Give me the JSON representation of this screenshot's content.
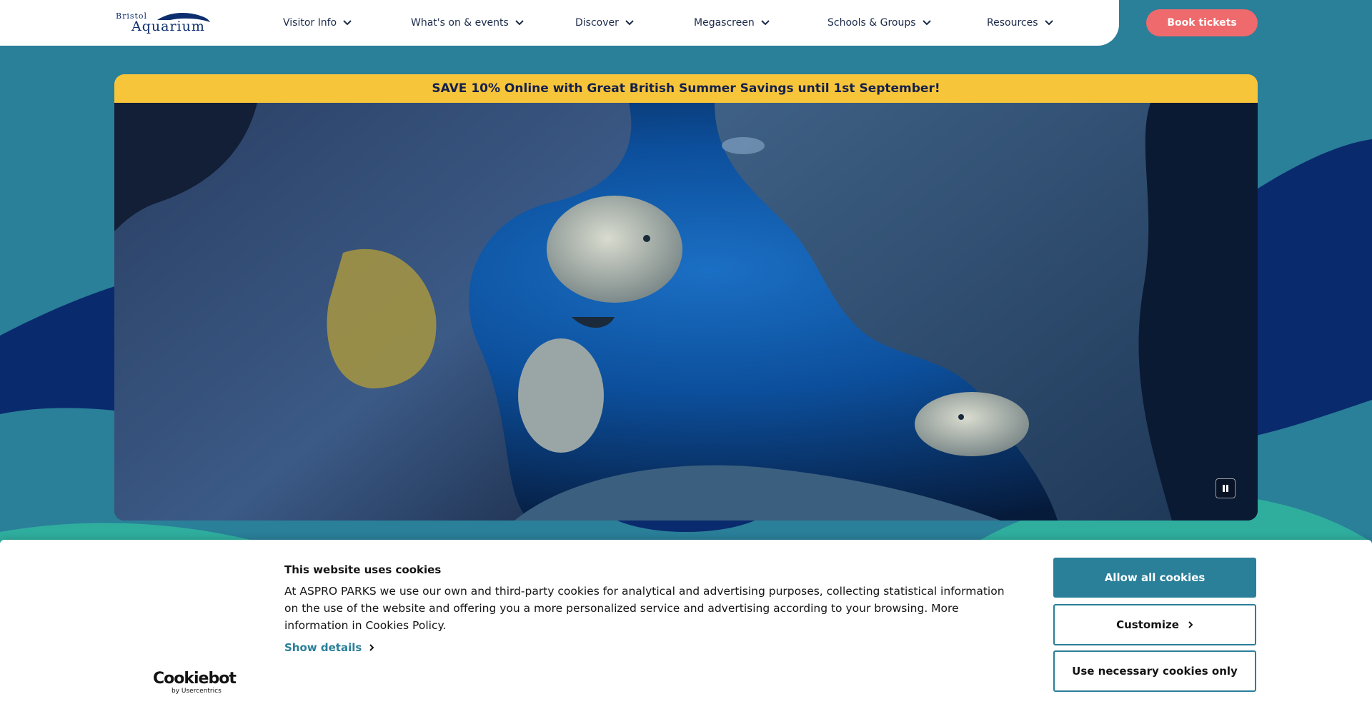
{
  "brand": {
    "logo_top": "Bristol",
    "logo_bottom": "Aquarium"
  },
  "nav": {
    "items": [
      {
        "label": "Visitor Info"
      },
      {
        "label": "What's on & events"
      },
      {
        "label": "Discover"
      },
      {
        "label": "Megascreen"
      },
      {
        "label": "Schools & Groups"
      },
      {
        "label": "Resources"
      }
    ],
    "book_label": "Book tickets"
  },
  "promo": {
    "text": "SAVE 10% Online with Great British Summer Savings until 1st September!"
  },
  "video": {
    "state": "playing"
  },
  "cookies": {
    "title": "This website uses cookies",
    "body": "At ASPRO PARKS we use our own and third-party cookies for analytical and advertising purposes, collecting statistical information on the use of the website and offering you a more personalized service and advertising according to your browsing. More information in Cookies Policy.",
    "show_details": "Show details",
    "allow_all": "Allow all cookies",
    "customize": "Customize",
    "necessary_only": "Use necessary cookies only",
    "provider": "Cookiebot",
    "provider_sub": "by Usercentrics"
  },
  "colors": {
    "background": "#2a7f99",
    "accent": "#ee6a6c",
    "promo": "#f7c53a",
    "navy": "#0d2e6e",
    "teal": "#2fae9e"
  }
}
